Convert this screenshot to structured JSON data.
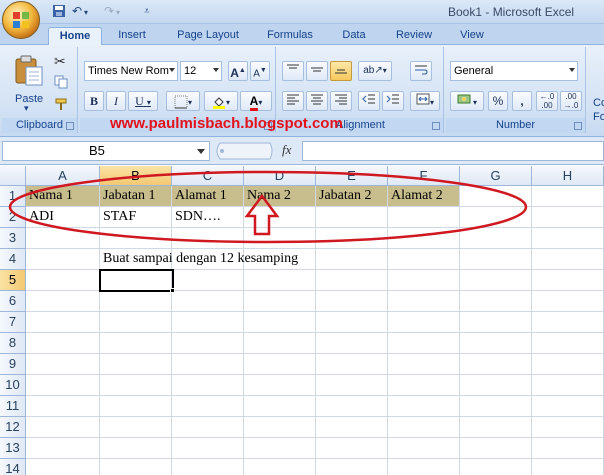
{
  "window": {
    "title": "Book1 - Microsoft Excel"
  },
  "tabs": [
    "Home",
    "Insert",
    "Page Layout",
    "Formulas",
    "Data",
    "Review",
    "View"
  ],
  "ribbon": {
    "clipboard": {
      "label": "Clipboard",
      "paste": "Paste"
    },
    "font": {
      "name": "Times New Rom",
      "size": "12",
      "bold": "B",
      "italic": "I",
      "underline": "U",
      "grow": "A",
      "shrink": "A",
      "color_letter": "A"
    },
    "alignment": {
      "label": "Alignment"
    },
    "number": {
      "label": "Number",
      "format": "General",
      "percent": "%",
      "comma": ",",
      "increase_decimal": "←.0 .00",
      "decrease_decimal": ".00 →.0"
    },
    "cut_off_label": "Co",
    "cut_off_label2": "Fo"
  },
  "watermark": "www.paulmisbach.blogspot.com",
  "formula_bar": {
    "name_box": "B5",
    "fx": "fx",
    "content": ""
  },
  "sheet": {
    "columns": [
      "A",
      "B",
      "C",
      "D",
      "E",
      "F",
      "G",
      "H"
    ],
    "rows": [
      "1",
      "2",
      "3",
      "4",
      "5",
      "6",
      "7",
      "8",
      "9",
      "10",
      "11",
      "12",
      "13",
      "14"
    ],
    "cells": {
      "A1": "Nama 1",
      "B1": "Jabatan 1",
      "C1": "Alamat 1",
      "D1": "Nama 2",
      "E1": "Jabatan 2",
      "F1": "Alamat 2",
      "A2": "ADI",
      "B2": "STAF",
      "C2": "SDN….",
      "B4": "Buat sampai dengan 12 kesamping"
    },
    "active_cell": "B5"
  },
  "colors": {
    "header_fill": "#c8bd8c",
    "annotation_red": "#d01820",
    "selected_header": "#f3c872"
  }
}
